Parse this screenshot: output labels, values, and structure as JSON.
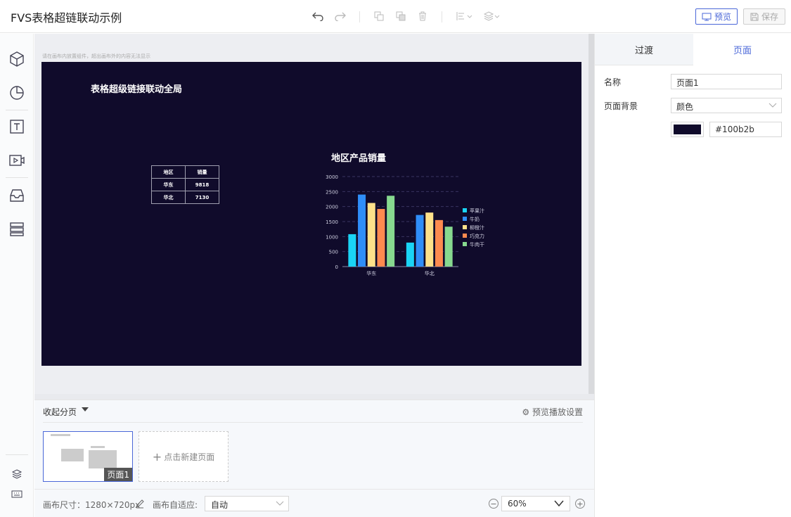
{
  "header": {
    "title": "FVS表格超链联动示例",
    "preview_label": "预览",
    "save_label": "保存"
  },
  "workspace": {
    "hint": "请在画布内放置组件，超出画布外的内容无法显示",
    "canvas_bg": "#100b2b",
    "canvas_title": "表格超级链接联动全局"
  },
  "table": {
    "headers": [
      "地区",
      "销量"
    ],
    "rows": [
      [
        "华东",
        "9818"
      ],
      [
        "华北",
        "7130"
      ]
    ]
  },
  "chart_data": {
    "type": "bar",
    "title": "地区产品销量",
    "categories": [
      "华东",
      "华北"
    ],
    "ylim": [
      0,
      3000
    ],
    "yticks": [
      0,
      500,
      1000,
      1500,
      2000,
      2500,
      3000
    ],
    "grid": true,
    "legend_position": "right",
    "series": [
      {
        "name": "苹果汁",
        "color": "#1ad4f5",
        "values": [
          1080,
          800
        ]
      },
      {
        "name": "牛奶",
        "color": "#2f8ef8",
        "values": [
          2400,
          1720
        ]
      },
      {
        "name": "柳橙汁",
        "color": "#fde18a",
        "values": [
          2120,
          1800
        ]
      },
      {
        "name": "巧克力",
        "color": "#fd8a4f",
        "values": [
          1920,
          1550
        ]
      },
      {
        "name": "牛肉干",
        "color": "#87d98f",
        "values": [
          2360,
          1330
        ]
      }
    ]
  },
  "pages": {
    "collapse_label": "收起分页",
    "preview_settings": "预览播放设置",
    "current_page": "页面1",
    "new_page": "点击新建页面"
  },
  "status": {
    "canvas_size": "画布尺寸：1280×720px",
    "auto_fit_label": "画布自适应:",
    "auto_fit_value": "自动",
    "zoom": "60%"
  },
  "rightpanel": {
    "tabs": [
      "过渡",
      "页面"
    ],
    "name_label": "名称",
    "name_value": "页面1",
    "bg_label": "页面背景",
    "bg_type": "颜色",
    "bg_color": "#100b2b"
  }
}
